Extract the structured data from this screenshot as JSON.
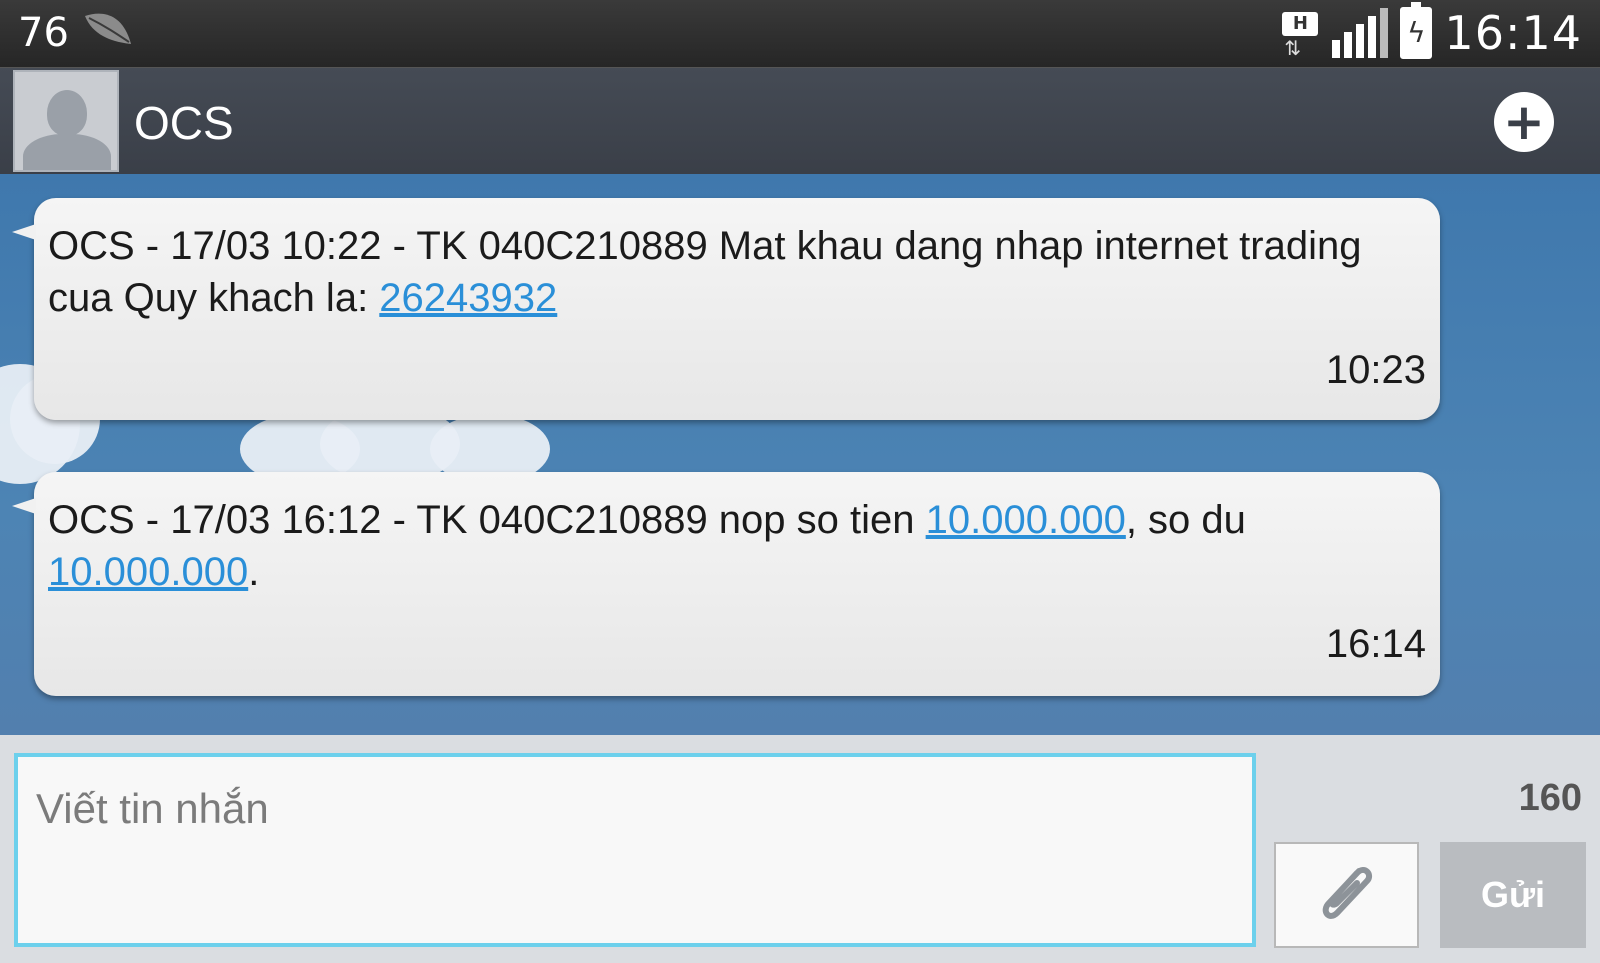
{
  "status_bar": {
    "notification_count": "76",
    "network_type": "H",
    "time": "16:14"
  },
  "header": {
    "contact_name": "OCS"
  },
  "messages": [
    {
      "text_prefix": "OCS - 17/03 10:22 - TK 040C210889 Mat khau dang nhap internet trading cua Quy khach la: ",
      "link1": "26243932",
      "time": "10:23"
    },
    {
      "text_prefix": "OCS - 17/03 16:12 - TK 040C210889 nop so tien ",
      "link1": "10.000.000",
      "text_middle": ", so du ",
      "link2": "10.000.000",
      "text_suffix": ".",
      "time": "16:14"
    }
  ],
  "compose": {
    "placeholder": "Viết tin nhắn",
    "char_counter": "160",
    "send_label": "Gửi"
  }
}
